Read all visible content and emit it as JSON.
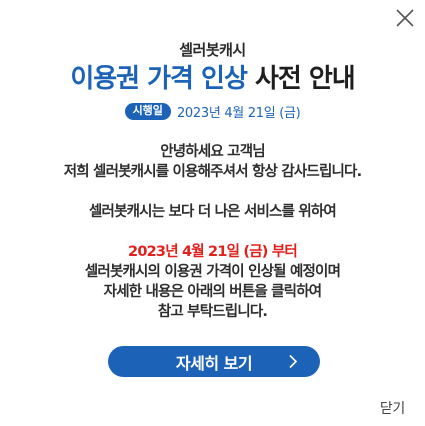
{
  "popup": {
    "brand": "셀러봇캐시",
    "headline_blue": "이용권 가격 인상",
    "headline_dark": "사전 안내",
    "date_badge": "시행일",
    "date": "2023년 4월 21일 (금)",
    "lines": {
      "greeting": "안녕하세요 고객님",
      "thanks": "저희 셀러봇캐시를 이용해주셔서 항상 감사드립니다.",
      "service": "셀러봇캐시는 보다 더 나은 서비스를 위하여",
      "effective": "2023년 4월 21일 (금) 부터",
      "price_notice": "셀러봇캐시의 이용권 가격이 인상될 예정이며",
      "detail": "자세한 내용은 아래의 버튼을 클릭하여",
      "reference": "참고 부탁드립니다."
    },
    "cta_label": "자세히 보기",
    "close_label": "닫기"
  },
  "colors": {
    "accent": "#1c63b8",
    "highlight": "#e2211c",
    "text": "#2e2e2e"
  }
}
